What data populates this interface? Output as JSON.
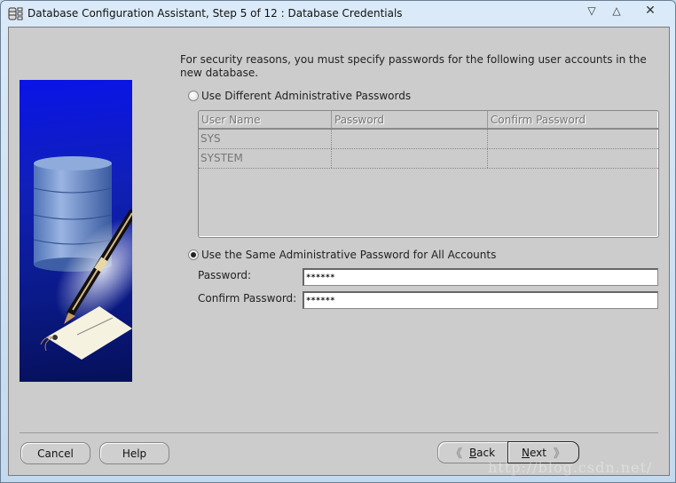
{
  "window": {
    "title": "Database Configuration Assistant, Step 5 of 12 : Database Credentials",
    "controls": {
      "minimize": "▽",
      "maximize": "△",
      "close": "✕"
    }
  },
  "intro_text": "For security reasons, you must specify passwords for the following user accounts in the new database.",
  "options": {
    "different": {
      "label": "Use Different Administrative Passwords",
      "selected": false
    },
    "same": {
      "label": "Use the Same Administrative Password for All Accounts",
      "selected": true
    }
  },
  "accounts_table": {
    "columns": [
      "User Name",
      "Password",
      "Confirm Password"
    ],
    "rows": [
      {
        "user": "SYS",
        "password": "",
        "confirm": ""
      },
      {
        "user": "SYSTEM",
        "password": "",
        "confirm": ""
      }
    ]
  },
  "same_password": {
    "password_label": "Password:",
    "password_value": "******",
    "confirm_label": "Confirm Password:",
    "confirm_value": "******"
  },
  "buttons": {
    "cancel": "Cancel",
    "help": "Help",
    "back_prefix": "",
    "back_mnemonic": "B",
    "back_rest": "ack",
    "next_mnemonic": "N",
    "next_rest": "ext"
  },
  "icons": {
    "back_arrow": "《",
    "next_arrow": "》"
  },
  "watermark": "http://blog.csdn.net/"
}
